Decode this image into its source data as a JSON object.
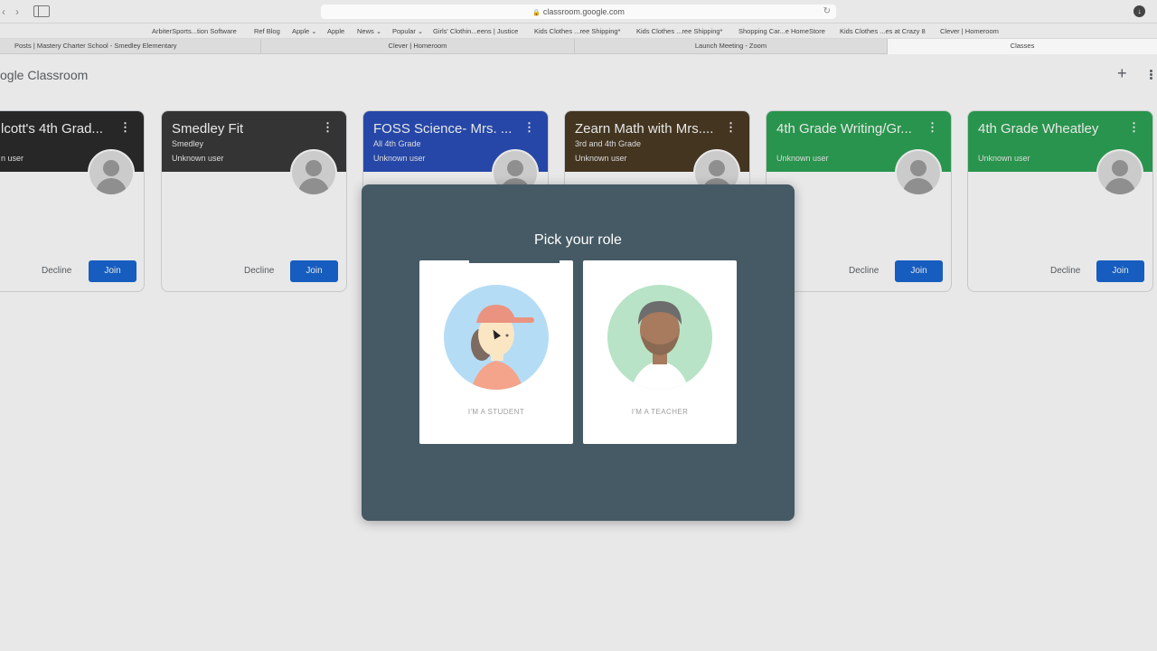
{
  "browser": {
    "url": "classroom.google.com",
    "bookmarks": [
      "ArbiterSports...tion Software",
      "Ref Blog",
      "Apple ⌄",
      "Apple",
      "News ⌄",
      "Popular ⌄",
      "Girls' Clothin...eens | Justice",
      "Kids Clothes ...ree Shipping*",
      "Kids Clothes ...ree Shipping*",
      "Shopping Car...e HomeStore",
      "Kids Clothes ...es at Crazy 8",
      "Clever | Homeroom"
    ],
    "tabs": [
      "Posts | Mastery Charter School - Smedley Elementary",
      "Clever | Homeroom",
      "Launch Meeting - Zoom",
      "Classes"
    ]
  },
  "app": {
    "logo": "ogle Classroom"
  },
  "classes": [
    {
      "title": "lcott's 4th Grad...",
      "subtitle": "",
      "teacher": "n user",
      "color": "#2b2b2b",
      "decline": "Decline",
      "join": "Join"
    },
    {
      "title": "Smedley Fit",
      "subtitle": "Smedley",
      "teacher": "Unknown user",
      "color": "#3a3a3a",
      "decline": "Decline",
      "join": "Join"
    },
    {
      "title": "FOSS Science- Mrs. ...",
      "subtitle": "All 4th Grade",
      "teacher": "Unknown user",
      "color": "#2a4fb8",
      "decline": "",
      "join": ""
    },
    {
      "title": "Zearn Math with Mrs....",
      "subtitle": "3rd and 4th Grade",
      "teacher": "Unknown user",
      "color": "#4a3b24",
      "decline": "",
      "join": ""
    },
    {
      "title": "4th Grade Writing/Gr...",
      "subtitle": "",
      "teacher": "Unknown user",
      "color": "#2ea355",
      "decline": "Decline",
      "join": "Join"
    },
    {
      "title": "4th Grade Wheatley",
      "subtitle": "",
      "teacher": "Unknown user",
      "color": "#2ea355",
      "decline": "Decline",
      "join": "Join"
    }
  ],
  "dialog": {
    "title": "Pick your role",
    "student_label": "I'M A STUDENT",
    "teacher_label": "I'M A TEACHER"
  }
}
